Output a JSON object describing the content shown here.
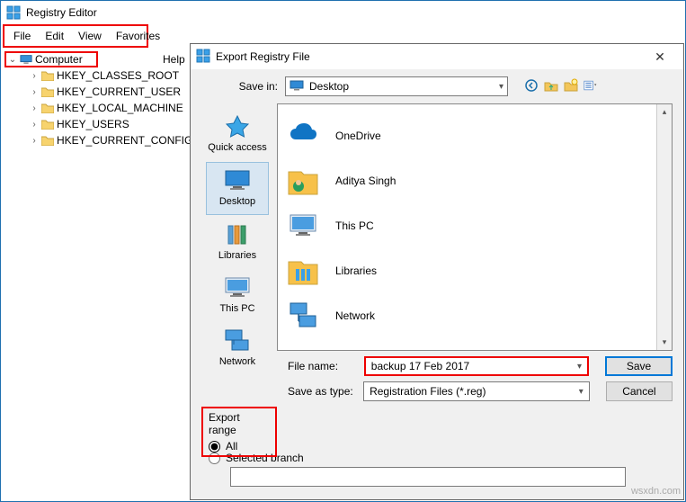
{
  "main": {
    "title": "Registry Editor",
    "menu": [
      "File",
      "Edit",
      "View",
      "Favorites",
      "Help"
    ],
    "tree": {
      "root": "Computer",
      "children": [
        "HKEY_CLASSES_ROOT",
        "HKEY_CURRENT_USER",
        "HKEY_LOCAL_MACHINE",
        "HKEY_USERS",
        "HKEY_CURRENT_CONFIG"
      ]
    }
  },
  "dialog": {
    "title": "Export Registry File",
    "save_in_label": "Save in:",
    "save_in_value": "Desktop",
    "sidebar": {
      "quick_access": "Quick access",
      "desktop": "Desktop",
      "libraries": "Libraries",
      "this_pc": "This PC",
      "network": "Network"
    },
    "list": {
      "onedrive": "OneDrive",
      "aditya": "Aditya Singh",
      "this_pc": "This PC",
      "libraries": "Libraries",
      "network": "Network"
    },
    "file_name_label": "File name:",
    "file_name_value": "backup 17 Feb 2017",
    "type_label": "Save as type:",
    "type_value": "Registration Files (*.reg)",
    "save_btn": "Save",
    "cancel_btn": "Cancel",
    "export_range_label": "Export range",
    "radio_all": "All",
    "radio_selected": "Selected branch"
  },
  "watermark": "wsxdn.com"
}
